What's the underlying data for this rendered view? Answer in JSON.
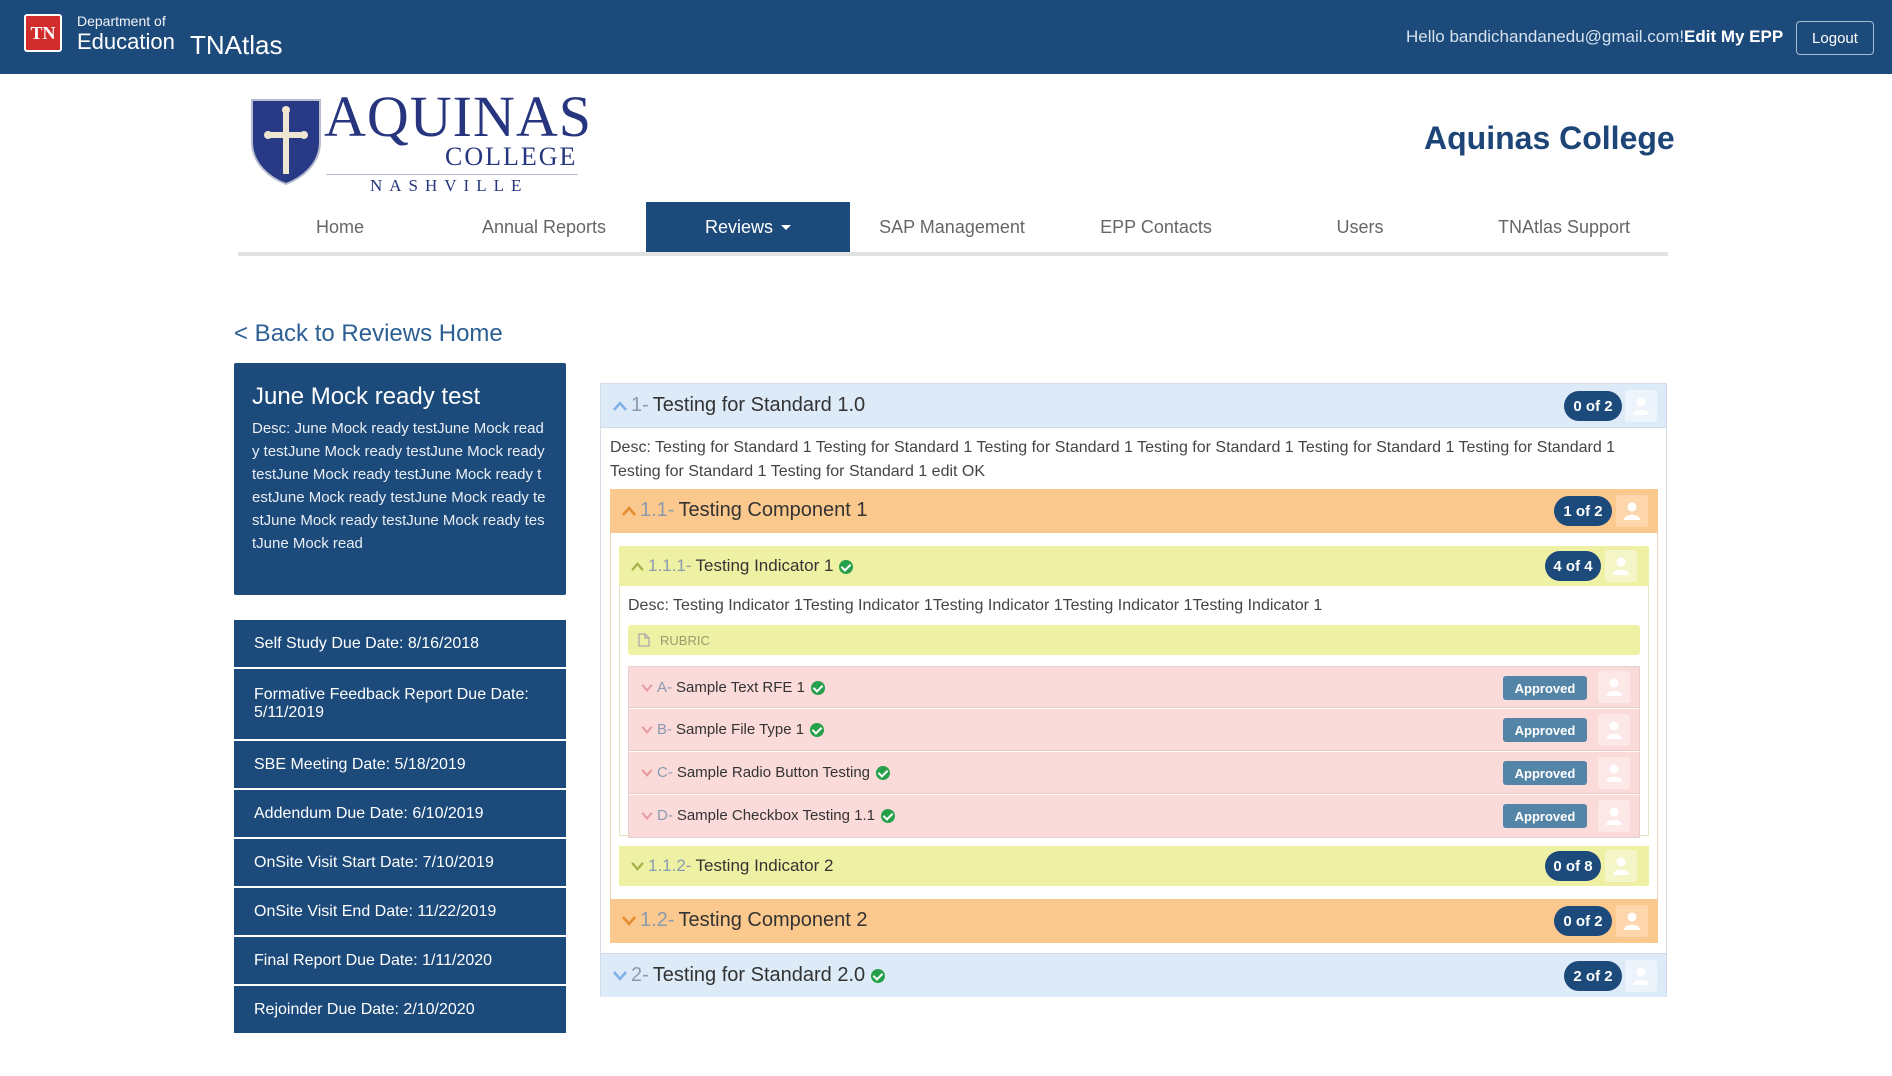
{
  "topbar": {
    "badge": "TN",
    "dept_line1": "Department of",
    "dept_line2": "Education",
    "app_name": "TNAtlas",
    "greeting": "Hello bandichandanedu@gmail.com!",
    "edit_epp": "Edit My EPP",
    "logout": "Logout"
  },
  "logo": {
    "word1": "AQUINAS",
    "word2": "COLLEGE",
    "word3": "NASHVILLE"
  },
  "college_name": "Aquinas College",
  "nav": {
    "items": [
      {
        "label": "Home"
      },
      {
        "label": "Annual Reports"
      },
      {
        "label": "Reviews",
        "active": true
      },
      {
        "label": "SAP Management"
      },
      {
        "label": "EPP Contacts"
      },
      {
        "label": "Users"
      },
      {
        "label": "TNAtlas Support"
      }
    ]
  },
  "back_link": "< Back to Reviews Home",
  "review": {
    "title": "June Mock ready test",
    "desc": "Desc: June Mock ready testJune Mock ready testJune Mock ready testJune Mock ready testJune Mock ready testJune Mock ready testJune Mock ready testJune Mock ready testJune Mock ready testJune Mock ready testJune Mock read"
  },
  "dates": [
    "Self Study Due Date: 8/16/2018",
    "Formative Feedback Report Due Date: 5/11/2019",
    "SBE Meeting Date: 5/18/2019",
    "Addendum Due Date: 6/10/2019",
    "OnSite Visit Start Date: 7/10/2019",
    "OnSite Visit End Date: 11/22/2019",
    "Final Report Due Date: 1/11/2020",
    "Rejoinder Due Date: 2/10/2020"
  ],
  "standards": [
    {
      "num": "1-",
      "title": "Testing for Standard 1.0",
      "count": "0 of 2",
      "desc": "Desc: Testing for Standard 1 Testing for Standard 1 Testing for Standard 1 Testing for Standard 1 Testing for Standard 1 Testing for Standard 1 Testing for Standard 1 Testing for Standard 1 edit OK",
      "components": [
        {
          "num": "1.1-",
          "title": "Testing Component 1",
          "count": "1 of 2",
          "indicators": [
            {
              "num": "1.1.1-",
              "title": "Testing Indicator 1",
              "count": "4 of 4",
              "desc": "Desc: Testing Indicator 1Testing Indicator 1Testing Indicator 1Testing Indicator 1Testing Indicator 1",
              "rubric": "RUBRIC",
              "items": [
                {
                  "num": "A-",
                  "title": "Sample Text RFE 1",
                  "status": "Approved"
                },
                {
                  "num": "B-",
                  "title": "Sample File Type 1",
                  "status": "Approved"
                },
                {
                  "num": "C-",
                  "title": "Sample Radio Button Testing",
                  "status": "Approved"
                },
                {
                  "num": "D-",
                  "title": "Sample Checkbox Testing 1.1",
                  "status": "Approved"
                }
              ]
            },
            {
              "num": "1.1.2-",
              "title": "Testing Indicator 2",
              "count": "0 of 8"
            }
          ]
        },
        {
          "num": "1.2-",
          "title": "Testing Component 2",
          "count": "0 of 2"
        }
      ]
    },
    {
      "num": "2-",
      "title": "Testing for Standard 2.0",
      "count": "2 of 2"
    }
  ],
  "colors": {
    "navy": "#1c4a7a",
    "standard_bg": "#ddeaf8",
    "component_bg": "#fbc98e",
    "indicator_bg": "#eef0a4",
    "item_bg": "#fbdada",
    "approved": "#5585a6",
    "check": "#26a04a"
  }
}
